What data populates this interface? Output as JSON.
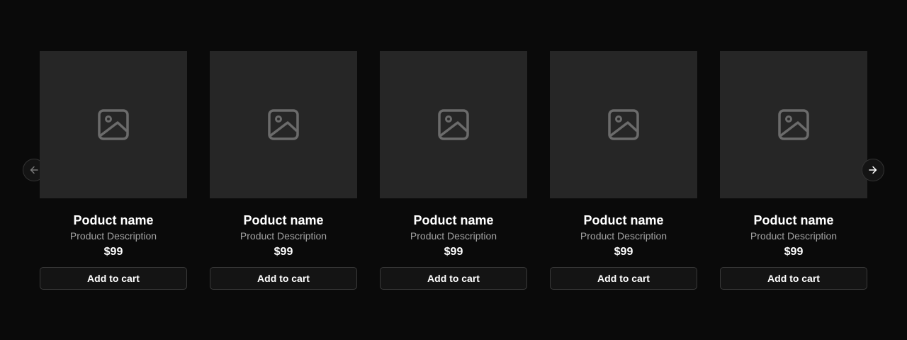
{
  "carousel": {
    "prev_icon": "arrow-left-icon",
    "next_icon": "arrow-right-icon",
    "placeholder_icon": "image-placeholder-icon"
  },
  "products": [
    {
      "name": "Poduct name",
      "description": "Product Description",
      "price": "$99",
      "button": "Add to cart"
    },
    {
      "name": "Poduct name",
      "description": "Product Description",
      "price": "$99",
      "button": "Add to cart"
    },
    {
      "name": "Poduct name",
      "description": "Product Description",
      "price": "$99",
      "button": "Add to cart"
    },
    {
      "name": "Poduct name",
      "description": "Product Description",
      "price": "$99",
      "button": "Add to cart"
    },
    {
      "name": "Poduct name",
      "description": "Product Description",
      "price": "$99",
      "button": "Add to cart"
    }
  ],
  "colors": {
    "background": "#0a0a0a",
    "card_image": "#262626",
    "icon": "#6b6b6b",
    "description": "#a3a3a3",
    "button_bg": "#141414"
  }
}
